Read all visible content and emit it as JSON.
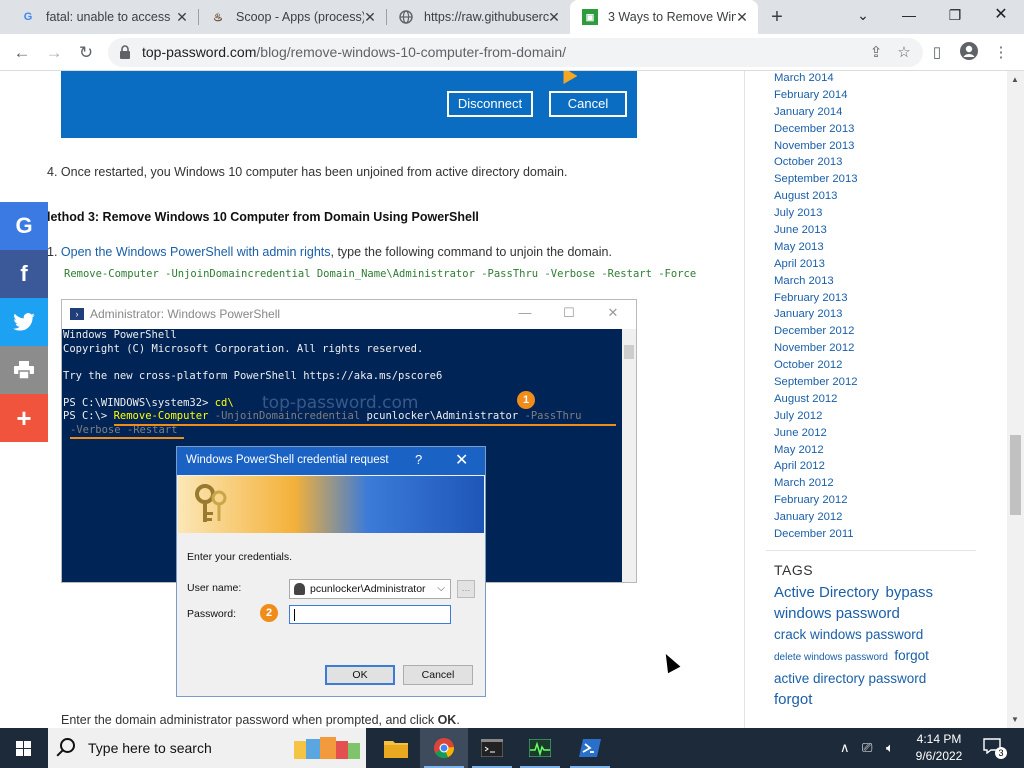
{
  "browser": {
    "tabs": [
      {
        "title": "fatal: unable to access",
        "icon": "google-icon",
        "active": false
      },
      {
        "title": "Scoop - Apps (process)",
        "icon": "scoop-icon",
        "active": false
      },
      {
        "title": "https://raw.githubuserc",
        "icon": "globe-icon",
        "active": false
      },
      {
        "title": "3 Ways to Remove Win",
        "icon": "top-password-icon",
        "active": true
      }
    ],
    "url_domain": "top-password.com",
    "url_path": "/blog/remove-windows-10-computer-from-domain/"
  },
  "article": {
    "hero_buttons": {
      "disconnect": "Disconnect",
      "cancel": "Cancel"
    },
    "step4_number": "4.",
    "step4_text": "Once restarted, you Windows 10 computer has been unjoined from active directory domain.",
    "method3_heading": "lethod 3: Remove Windows 10 Computer from Domain Using PowerShell",
    "step1_number": "1.",
    "step1_link": "Open the Windows PowerShell with admin rights",
    "step1_rest": ", type the following command to unjoin the domain.",
    "command": "Remove-Computer -UnjoinDomaincredential Domain_Name\\Administrator -PassThru -Verbose -Restart -Force",
    "powershell": {
      "title": "Administrator: Windows PowerShell",
      "lines": [
        "Windows PowerShell",
        "Copyright (C) Microsoft Corporation. All rights reserved.",
        "",
        "Try the new cross-platform PowerShell https://aka.ms/pscore6",
        ""
      ],
      "prompt1": "PS C:\\WINDOWS\\system32>",
      "cmd1": "cd\\",
      "prompt2": "PS C:\\>",
      "cmd2_name": "Remove-Computer",
      "cmd2_param1": "-UnjoinDomaincredential",
      "cmd2_value": "pcunlocker\\Administrator",
      "cmd2_param2": "-PassThru",
      "cmd2_line2": "-Verbose -Restart",
      "watermark": "top-password.com",
      "badge1": "1",
      "badge2": "2"
    },
    "credential_dialog": {
      "title": "Windows PowerShell credential request",
      "help": "?",
      "prompt": "Enter your credentials.",
      "username_label": "User name:",
      "username_value": "pcunlocker\\Administrator",
      "password_label": "Password:",
      "ok": "OK",
      "cancel": "Cancel"
    },
    "bottom_text": "Enter the domain administrator password when prompted, and click ",
    "bottom_bold": "OK",
    "bottom_end": "."
  },
  "share_bar": [
    {
      "label": "G",
      "icon": "google-icon",
      "color": "#3b79e3"
    },
    {
      "label": "f",
      "icon": "facebook-icon",
      "color": "#3b5998"
    },
    {
      "label": "t",
      "icon": "twitter-icon",
      "color": "#1da1f2"
    },
    {
      "label": "print",
      "icon": "print-icon",
      "color": "#8c8c8c"
    },
    {
      "label": "+",
      "icon": "more-icon",
      "color": "#f0543c"
    }
  ],
  "sidebar": {
    "archives": [
      "March 2014",
      "February 2014",
      "January 2014",
      "December 2013",
      "November 2013",
      "October 2013",
      "September 2013",
      "August 2013",
      "July 2013",
      "June 2013",
      "May 2013",
      "April 2013",
      "March 2013",
      "February 2013",
      "January 2013",
      "December 2012",
      "November 2012",
      "October 2012",
      "September 2012",
      "August 2012",
      "July 2012",
      "June 2012",
      "May 2012",
      "April 2012",
      "March 2012",
      "February 2012",
      "January 2012",
      "December 2011"
    ],
    "tags_heading": "TAGS",
    "tags": [
      {
        "text": "Active Directory",
        "size": 15
      },
      {
        "text": "bypass windows password",
        "size": 15
      },
      {
        "text": "crack windows password",
        "size": 13.5
      },
      {
        "text": "delete windows password",
        "size": 10
      },
      {
        "text": "forgot active directory password",
        "size": 13.5
      },
      {
        "text": "forgot",
        "size": 15
      }
    ]
  },
  "taskbar": {
    "search_placeholder": "Type here to search",
    "time": "4:14 PM",
    "date": "9/6/2022",
    "notification_count": "3"
  }
}
